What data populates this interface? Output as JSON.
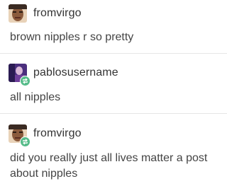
{
  "posts": [
    {
      "username": "fromvirgo",
      "text": "brown nipples r so pretty",
      "avatar_icon": "face-avatar-icon",
      "reblogged": false
    },
    {
      "username": "pablosusername",
      "text": "all nipples",
      "avatar_icon": "purple-portrait-avatar-icon",
      "reblogged": true
    },
    {
      "username": "fromvirgo",
      "text": "did you really just all lives matter a post about nipples",
      "avatar_icon": "face-avatar-icon",
      "reblogged": true
    }
  ],
  "colors": {
    "reblog_badge": "#56bc8a",
    "divider": "#e6e6e6",
    "text": "#444444"
  }
}
